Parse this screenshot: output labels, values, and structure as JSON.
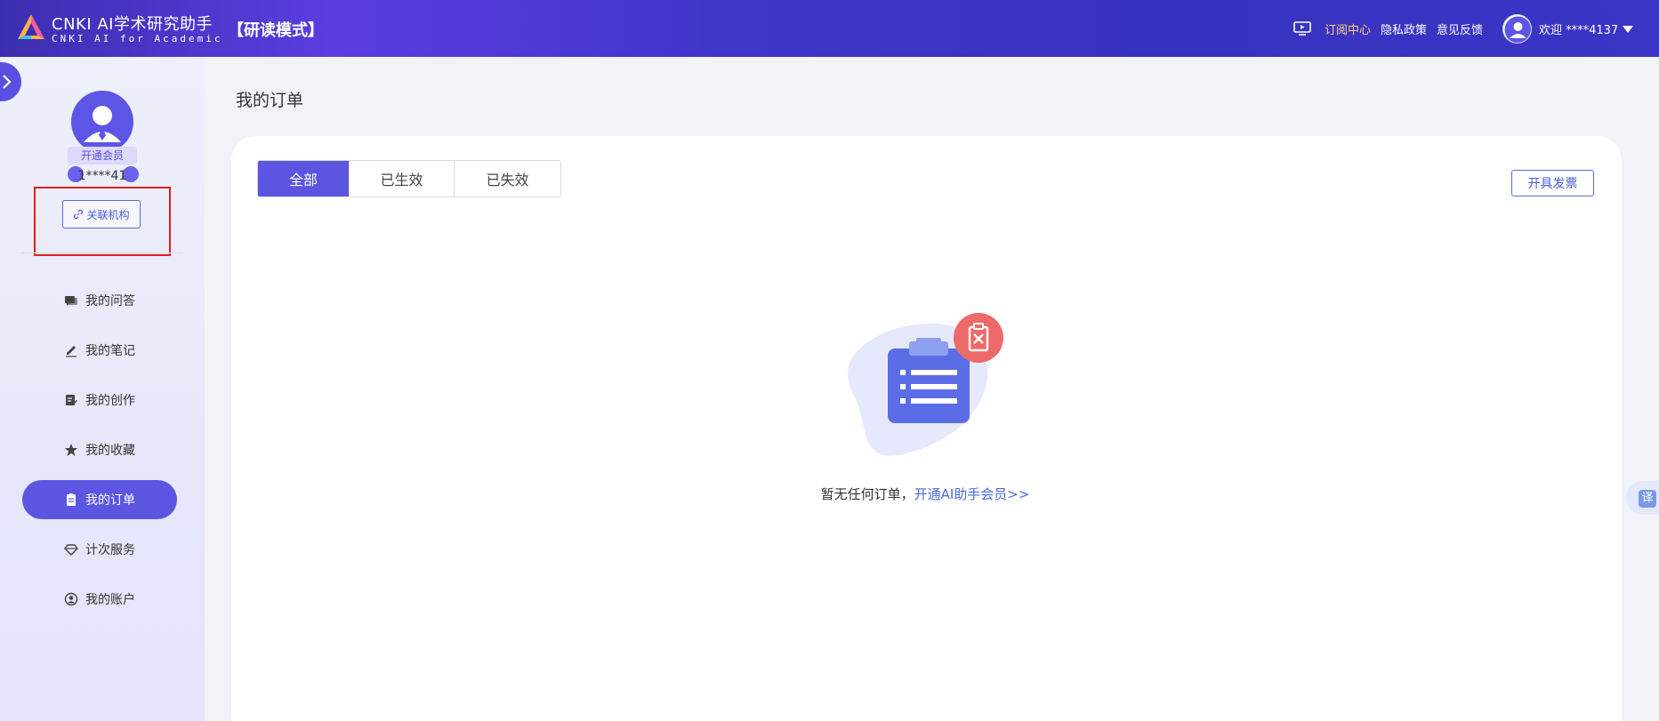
{
  "header": {
    "brand_title": "CNKI AI学术研究助手",
    "brand_subtitle": "CNKI AI for Academic",
    "mode": "【研读模式】",
    "nav": {
      "subscription_center": "订阅中心",
      "privacy_policy": "隐私政策",
      "feedback": "意见反馈"
    },
    "welcome": "欢迎    ****4137"
  },
  "sidebar": {
    "member_badge": "开通会员",
    "user_id": "1****41",
    "link_org_button": "关联机构",
    "menu": [
      {
        "label": "我的问答",
        "icon": "chat-icon"
      },
      {
        "label": "我的笔记",
        "icon": "pen-icon"
      },
      {
        "label": "我的创作",
        "icon": "edit-doc-icon"
      },
      {
        "label": "我的收藏",
        "icon": "star-icon"
      },
      {
        "label": "我的订单",
        "icon": "order-icon",
        "active": true
      },
      {
        "label": "计次服务",
        "icon": "diamond-icon"
      },
      {
        "label": "我的账户",
        "icon": "user-circle-icon"
      }
    ]
  },
  "main": {
    "page_title": "我的订单",
    "tabs": [
      {
        "label": "全部",
        "active": true
      },
      {
        "label": "已生效"
      },
      {
        "label": "已失效"
      }
    ],
    "invoice_button": "开具发票",
    "empty_text": "暂无任何订单，",
    "empty_link": "开通AI助手会员>>"
  },
  "translate_tab": "译",
  "colors": {
    "accent": "#5b55e2",
    "link": "#4a6ad8",
    "subscription_highlight": "#ffd27a",
    "highlight_box": "#e01f1f"
  }
}
